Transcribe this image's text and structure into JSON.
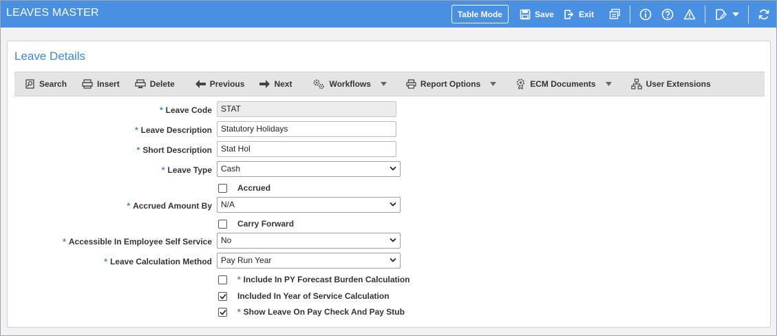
{
  "header": {
    "title": "LEAVES MASTER",
    "table_mode": "Table Mode",
    "save": "Save",
    "exit": "Exit",
    "icons": [
      "save-icon",
      "exit-icon",
      "print-icon",
      "info-icon",
      "help-icon",
      "warning-icon",
      "edit-icon",
      "chevron-down-icon",
      "refresh-icon"
    ]
  },
  "panel": {
    "title": "Leave Details"
  },
  "toolbar": {
    "search": "Search",
    "insert": "Insert",
    "delete": "Delete",
    "previous": "Previous",
    "next": "Next",
    "workflows": "Workflows",
    "report_options": "Report Options",
    "ecm_documents": "ECM Documents",
    "user_extensions": "User Extensions"
  },
  "form": {
    "required_mark": "*",
    "leave_code": {
      "label": "Leave Code",
      "value": "STAT"
    },
    "leave_description": {
      "label": "Leave Description",
      "value": "Statutory Holidays"
    },
    "short_description": {
      "label": "Short Description",
      "value": "Stat Hol"
    },
    "leave_type": {
      "label": "Leave Type",
      "value": "Cash"
    },
    "accrued": {
      "label": "Accrued",
      "checked": false
    },
    "accrued_amount_by": {
      "label": "Accrued Amount By",
      "value": "N/A"
    },
    "carry_forward": {
      "label": "Carry Forward",
      "checked": false
    },
    "accessible_ess": {
      "label": "Accessible In Employee Self Service",
      "value": "No"
    },
    "leave_calc_method": {
      "label": "Leave Calculation Method",
      "value": "Pay Run Year"
    },
    "include_py_forecast": {
      "label": "Include In PY Forecast Burden Calculation",
      "checked": false
    },
    "included_year_service": {
      "label": "Included In Year of Service Calculation",
      "checked": true
    },
    "show_leave_paycheck": {
      "label": "Show Leave On Pay Check And Pay Stub",
      "checked": true
    }
  },
  "colors": {
    "header_bg": "#4a90e2",
    "panel_title": "#3f86d6",
    "required": "#3f7fd0",
    "toolbar_bg": "#e4e4e4"
  }
}
